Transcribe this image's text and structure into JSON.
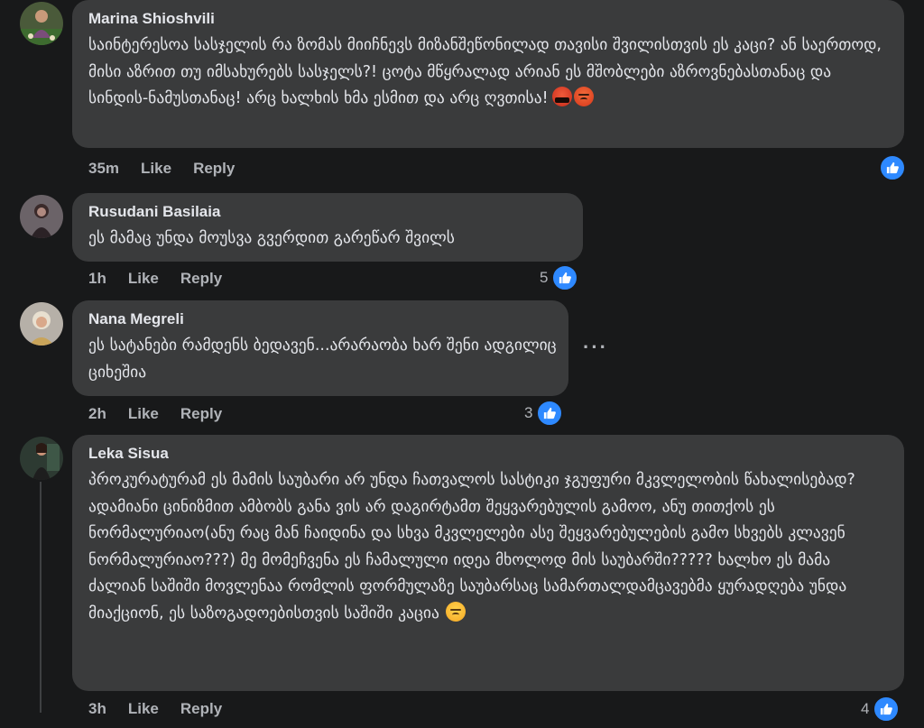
{
  "comments": [
    {
      "author": "Marina Shioshvili",
      "text": "საინტერესოა სასჯელის რა ზომას მიიჩნევს მიზანშეწონილად თავისი შვილისთვის ეს კაცი? ან საერთოდ, მისი აზრით თუ იმსახურებს სასჯელს?! ცოტა მწყრალად არიან ეს მშობლები აზროვნებასთანაც და სინდის-ნამუსთანაც! არც ხალხის ხმა ესმით და არც ღვთისა!",
      "time": "35m",
      "like_label": "Like",
      "reply_label": "Reply",
      "reaction_count": "",
      "emojis": [
        "face-with-symbols-on-mouth",
        "pouting-face"
      ]
    },
    {
      "author": "Rusudani Basilaia",
      "text": "ეს მამაც უნდა მოუსვა გვერდით გარეწარ შვილს",
      "time": "1h",
      "like_label": "Like",
      "reply_label": "Reply",
      "reaction_count": "5"
    },
    {
      "author": "Nana Megreli",
      "text": "ეს სატანები რამდენს ბედავენ...არარაობა ხარ შენი ადგილიც ციხეშია",
      "time": "2h",
      "like_label": "Like",
      "reply_label": "Reply",
      "reaction_count": "3",
      "more_label": "···"
    },
    {
      "author": "Leka Sisua",
      "text": "პროკურატურამ ეს მამის საუბარი არ უნდა ჩათვალოს სასტიკი ჯგუფური მკვლელობის წახალისებად? ადამიანი ცინიზმით ამბობს განა ვის არ დაგირტამთ შეყვარებულის გამოო, ანუ თითქოს ეს ნორმალურიაო(ანუ რაც მან ჩაიდინა და სხვა მკვლელები ასე შეყვარებულების გამო სხვებს კლავენ ნორმალურიაო???) მე მომეჩვენა ეს ჩამალული იდეა მხოლოდ მის საუბარში????? ხალხო ეს მამა ძალიან საშიში მოვლენაა რომლის ფორმულაზე საუბარსაც სამართალდამცავებმა ყურადღება უნდა მიაქციონ, ეს საზოგადოებისთვის საშიში კაცია",
      "time": "3h",
      "like_label": "Like",
      "reply_label": "Reply",
      "reaction_count": "4",
      "emojis": [
        "worried-face"
      ]
    }
  ],
  "colors": {
    "background": "#18191a",
    "bubble": "#3a3b3c",
    "text": "#e4e6eb",
    "secondary_text": "#b0b3b8",
    "like_blue": "#2e89ff"
  },
  "icons": {
    "reaction": "thumbs-up-icon",
    "more": "more-dots-icon"
  }
}
